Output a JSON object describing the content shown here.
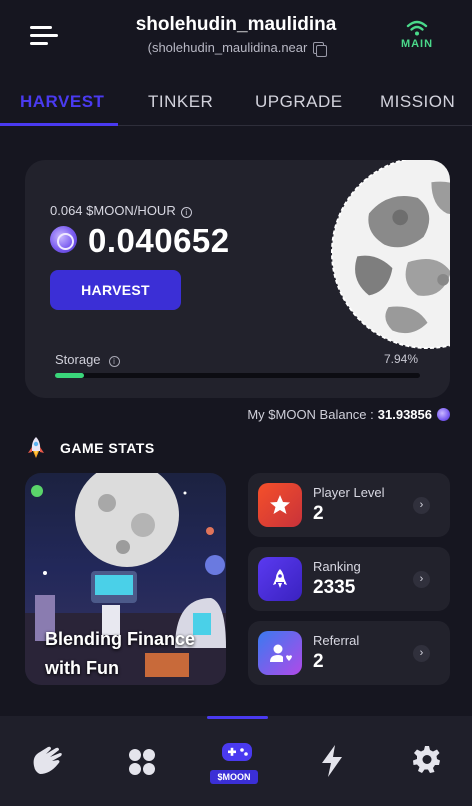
{
  "header": {
    "username": "sholehudin_maulidina",
    "account": "(sholehudin_maulidina.near",
    "network": "MAIN",
    "menu_icon": "hamburger-icon",
    "copy_icon": "copy-icon",
    "network_icon": "wifi-icon"
  },
  "tabs": [
    {
      "label": "HARVEST",
      "active": true
    },
    {
      "label": "TINKER",
      "active": false
    },
    {
      "label": "UPGRADE",
      "active": false
    },
    {
      "label": "MISSION",
      "active": false
    }
  ],
  "harvest": {
    "rate": "0.064 $MOON/HOUR",
    "balance": "0.040652",
    "button": "HARVEST",
    "storage_label": "Storage",
    "storage_percent": "7.94%",
    "storage_fraction": 0.0794
  },
  "my_balance": {
    "label": "My $MOON Balance :",
    "value": "31.93856"
  },
  "game_stats": {
    "title": "GAME STATS",
    "banner_text": "Blending Finance with Fun",
    "items": [
      {
        "label": "Player Level",
        "value": "2",
        "icon": "star-icon",
        "color": "#e84a2c"
      },
      {
        "label": "Ranking",
        "value": "2335",
        "icon": "rocket-icon",
        "color": "#4a2ee0"
      },
      {
        "label": "Referral",
        "value": "2",
        "icon": "user-heart-icon",
        "color": "#a05af0"
      }
    ]
  },
  "bottom_nav": {
    "items": [
      "hand-icon",
      "apps-icon",
      "gamepad-icon",
      "lightning-icon",
      "gear-icon"
    ],
    "active_label": "$MOON"
  },
  "colors": {
    "accent": "#4a3af0",
    "success": "#3ad67a",
    "network": "#4ad98a",
    "background": "#161620",
    "card": "#22222c"
  }
}
